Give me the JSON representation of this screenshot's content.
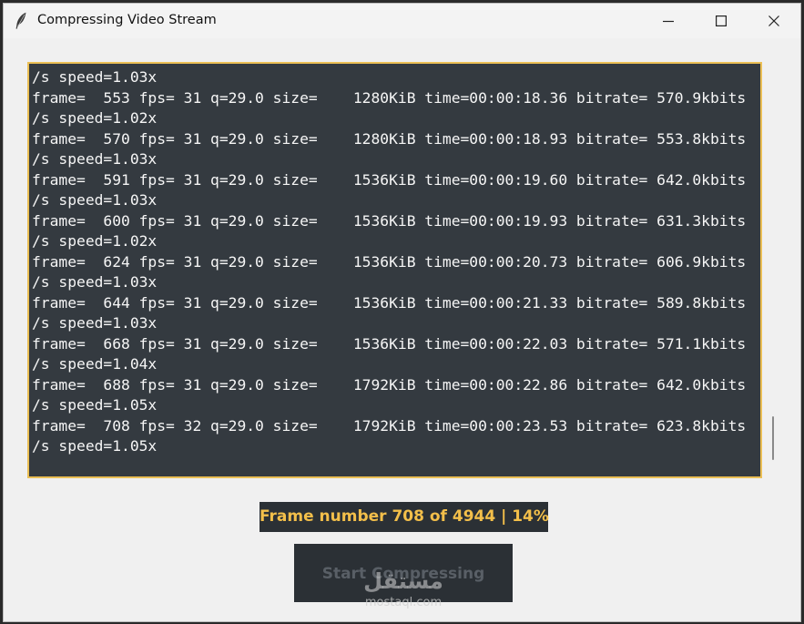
{
  "window": {
    "title": "Compressing Video Stream",
    "icon": "feather-icon"
  },
  "console": {
    "lines": [
      "/s speed=1.03x",
      "frame=  553 fps= 31 q=29.0 size=    1280KiB time=00:00:18.36 bitrate= 570.9kbits",
      "/s speed=1.02x",
      "frame=  570 fps= 31 q=29.0 size=    1280KiB time=00:00:18.93 bitrate= 553.8kbits",
      "/s speed=1.03x",
      "frame=  591 fps= 31 q=29.0 size=    1536KiB time=00:00:19.60 bitrate= 642.0kbits",
      "/s speed=1.03x",
      "frame=  600 fps= 31 q=29.0 size=    1536KiB time=00:00:19.93 bitrate= 631.3kbits",
      "/s speed=1.02x",
      "frame=  624 fps= 31 q=29.0 size=    1536KiB time=00:00:20.73 bitrate= 606.9kbits",
      "/s speed=1.03x",
      "frame=  644 fps= 31 q=29.0 size=    1536KiB time=00:00:21.33 bitrate= 589.8kbits",
      "/s speed=1.03x",
      "frame=  668 fps= 31 q=29.0 size=    1536KiB time=00:00:22.03 bitrate= 571.1kbits",
      "/s speed=1.04x",
      "frame=  688 fps= 31 q=29.0 size=    1792KiB time=00:00:22.86 bitrate= 642.0kbits",
      "/s speed=1.05x",
      "frame=  708 fps= 32 q=29.0 size=    1792KiB time=00:00:23.53 bitrate= 623.8kbits",
      "/s speed=1.05x"
    ]
  },
  "progress": {
    "label": "Frame number 708 of 4944 | 14%"
  },
  "actions": {
    "start_label": "Start Compressing"
  },
  "watermark": {
    "arabic": "مستقل",
    "latin": "mostaql.com"
  },
  "colors": {
    "accent": "#ebbf55",
    "console_bg": "#343a40",
    "label_bg": "#2b3035",
    "label_text": "#f3bf4a"
  }
}
